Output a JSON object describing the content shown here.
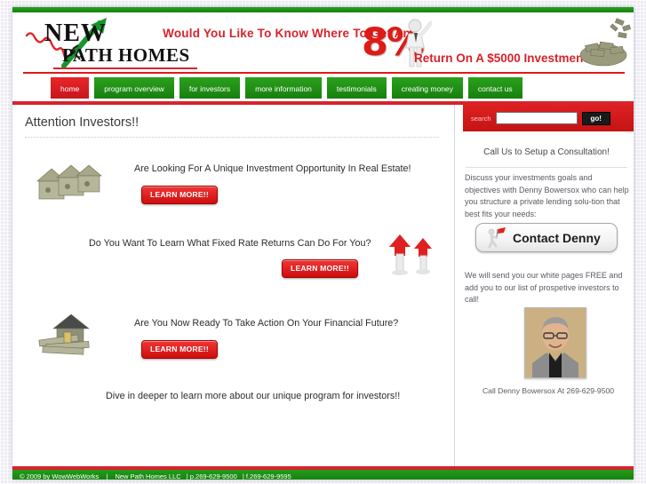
{
  "site": {
    "logo_line1": "NEW",
    "logo_line2": "PATH HOMES"
  },
  "banner": {
    "headline": "Would You Like To Know Where To Get An",
    "percent": "8%",
    "headline_tail": "Return On A $5000 Investment?"
  },
  "nav": {
    "items": [
      {
        "label": "home",
        "active": true
      },
      {
        "label": "program overview",
        "active": false
      },
      {
        "label": "for investors",
        "active": false
      },
      {
        "label": "more information",
        "active": false
      },
      {
        "label": "testimonials",
        "active": false
      },
      {
        "label": "creating money",
        "active": false
      },
      {
        "label": "contact us",
        "active": false
      }
    ]
  },
  "main": {
    "title": "Attention Investors!!",
    "promos": [
      {
        "text": "Are Looking For A Unique Investment Opportunity In Real Estate!",
        "button": "LEARN MORE!!",
        "image": "houses-made-of-money-image"
      },
      {
        "text": "Do You Want To Learn What Fixed Rate Returns Can Do For You?",
        "button": "LEARN MORE!!",
        "image": "figures-with-red-arrows-image"
      },
      {
        "text": "Are You Now Ready To Take Action On Your Financial Future?",
        "button": "LEARN MORE!!",
        "image": "house-on-money-stack-image"
      }
    ],
    "closing": "Dive in deeper to learn more about our unique program for investors!!"
  },
  "sidebar": {
    "search_label": "search",
    "search_value": "",
    "search_placeholder": "",
    "go_label": "go!",
    "heading": "Call Us to Setup a Consultation!",
    "paragraph": "Discuss your investments goals and objectives with Denny Bowersox who can help you structure a private lending solu-tion that best fits your needs:",
    "contact_button": "Contact Denny",
    "note": "We will send you our white pages FREE and add you to our list of prospetive investors to call!",
    "portrait_alt": "denny-bowersox-portrait",
    "caption": "Call Denny Bowersox At 269-629-9500"
  },
  "footer": {
    "copyright": "© 2009 by WowWebWorks",
    "separator": "|",
    "company": "New Path Homes LLC",
    "phone": "| p.269-629-9500",
    "fax": "| f.269-629-9595"
  },
  "colors": {
    "brand_red": "#d8232b",
    "brand_green": "#1e8c16",
    "percent_red": "#e01a16"
  }
}
